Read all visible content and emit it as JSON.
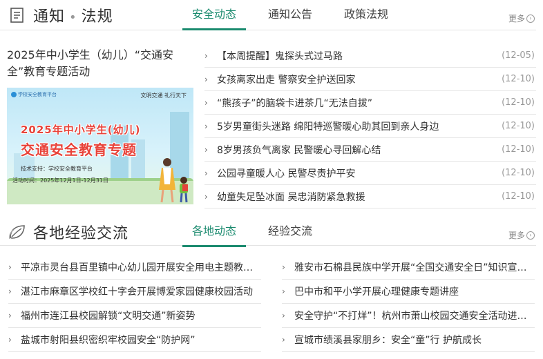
{
  "notice": {
    "title_a": "通知",
    "title_sep": "•",
    "title_b": "法规",
    "icon": "document-icon",
    "tabs": [
      {
        "label": "安全动态",
        "active": true
      },
      {
        "label": "通知公告",
        "active": false
      },
      {
        "label": "政策法规",
        "active": false
      }
    ],
    "more": "更多",
    "feature": {
      "title": "2025年中小学生（幼儿）“交通安全”教育专题活动",
      "banner": {
        "logo": "学校安全教育平台",
        "slogan": "文明交通  礼行天下",
        "line1": "2025年中小学生(幼儿)",
        "line2": "交通安全教育专题",
        "support": "技术支持：学校安全教育平台",
        "period": "活动时间：2025年12月1日-12月31日"
      }
    },
    "items": [
      {
        "text": "【本周提醒】鬼探头式过马路",
        "date": "(12-05)"
      },
      {
        "text": "女孩离家出走 警察安全护送回家",
        "date": "(12-10)"
      },
      {
        "text": "“熊孩子”的脑袋卡进茶几“无法自拔”",
        "date": "(12-10)"
      },
      {
        "text": "5岁男童街头迷路 绵阳特巡警暖心助其回到亲人身边",
        "date": "(12-10)"
      },
      {
        "text": "8岁男孩负气离家 民警暖心寻回解心结",
        "date": "(12-10)"
      },
      {
        "text": "公园寻童暖人心 民警尽责护平安",
        "date": "(12-10)"
      },
      {
        "text": "幼童失足坠冰面 吴忠消防紧急救援",
        "date": "(12-10)"
      }
    ]
  },
  "experience": {
    "title": "各地经验交流",
    "icon": "leaf-icon",
    "tabs": [
      {
        "label": "各地动态",
        "active": true
      },
      {
        "label": "经验交流",
        "active": false
      }
    ],
    "more": "更多",
    "left_items": [
      "平凉市灵台县百里镇中心幼儿园开展安全用电主题教育活动",
      "湛江市麻章区学校红十字会开展博爱家园健康校园活动",
      "福州市连江县校园解锁“文明交通”新姿势",
      "盐城市射阳县织密织牢校园安全“防护网”"
    ],
    "right_items": [
      "雅安市石棉县民族中学开展“全国交通安全日”知识宣传活动",
      "巴中市和平小学开展心理健康专题讲座",
      "安全守护“不打烊”！杭州市萧山校园交通安全活动进行时",
      "宣城市绩溪县家朋乡：安全“童”行 护航成长"
    ]
  },
  "colors": {
    "accent": "#1a8a6e",
    "text": "#333333",
    "muted": "#999999",
    "banner_red": "#e8433a"
  }
}
